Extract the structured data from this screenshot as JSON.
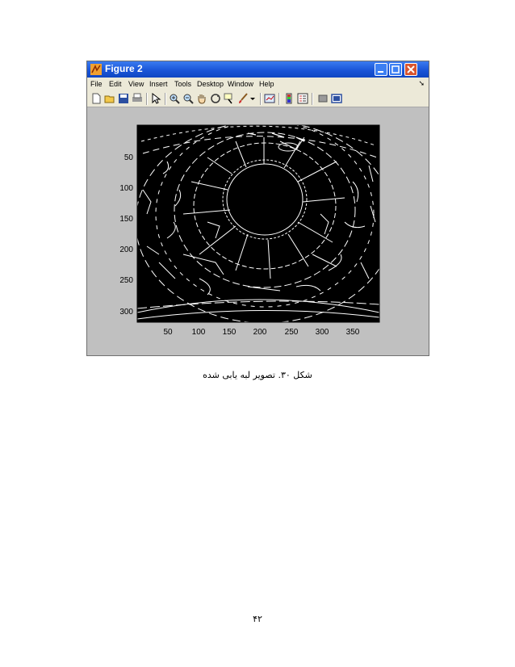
{
  "window": {
    "title": "Figure 2",
    "menu": [
      "File",
      "Edit",
      "View",
      "Insert",
      "Tools",
      "Desktop",
      "Window",
      "Help"
    ],
    "toolbar_icons": [
      "new-figure-icon",
      "open-file-icon",
      "save-icon",
      "print-icon",
      "pointer-icon",
      "zoom-in-icon",
      "zoom-out-icon",
      "pan-icon",
      "rotate-3d-icon",
      "data-cursor-icon",
      "brush-icon",
      "brush-dropdown-icon",
      "link-plot-icon",
      "insert-colorbar-icon",
      "insert-legend-icon",
      "hide-plot-tools-icon",
      "show-plot-tools-icon"
    ]
  },
  "plot": {
    "description_image": "edge-detected eye image (black background, white edges)",
    "xticks": [
      "50",
      "100",
      "150",
      "200",
      "250",
      "300",
      "350"
    ],
    "yticks": [
      "50",
      "100",
      "150",
      "200",
      "250",
      "300"
    ],
    "xlim": [
      0,
      393
    ],
    "ylim": [
      0,
      318
    ]
  },
  "caption": "شکل ۳۰. تصویر لبه یابی شده",
  "page_number": "۴۲"
}
